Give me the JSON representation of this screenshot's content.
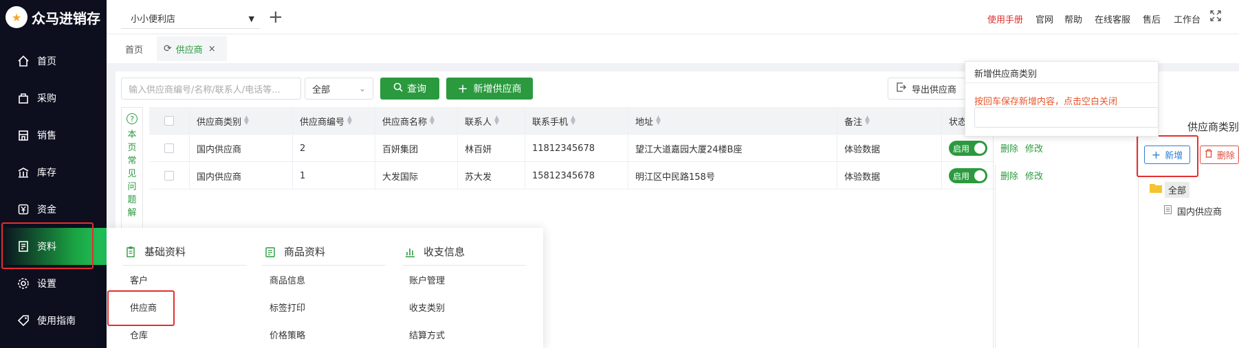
{
  "app": {
    "name": "众马进销存"
  },
  "sidebar": {
    "items": [
      {
        "label": "首页",
        "icon": "home-icon"
      },
      {
        "label": "采购",
        "icon": "bag-icon"
      },
      {
        "label": "销售",
        "icon": "shop-icon"
      },
      {
        "label": "库存",
        "icon": "warehouse-icon"
      },
      {
        "label": "资金",
        "icon": "yuan-icon"
      },
      {
        "label": "资料",
        "icon": "document-icon",
        "active": true
      },
      {
        "label": "设置",
        "icon": "gear-icon"
      },
      {
        "label": "使用指南",
        "icon": "tag-icon"
      }
    ]
  },
  "header": {
    "store": "小小便利店",
    "links": {
      "manual": "使用手册",
      "website": "官网",
      "help": "帮助",
      "service": "在线客服",
      "aftersale": "售后",
      "workbench": "工作台"
    },
    "accent": "#e02a2a"
  },
  "tabs": {
    "home": "首页",
    "current": "供应商",
    "close": "×"
  },
  "toolbar": {
    "search_placeholder": "输入供应商编号/名称/联系人/电话等...",
    "filter_value": "全部",
    "query_label": "查询",
    "add_label": "新增供应商",
    "export_label": "导出供应商"
  },
  "faq": {
    "text": "本页常见问题解"
  },
  "table": {
    "headers": [
      "供应商类别",
      "供应商编号",
      "供应商名称",
      "联系人",
      "联系手机",
      "地址",
      "备注",
      "状态"
    ],
    "rows": [
      {
        "category": "国内供应商",
        "code": "2",
        "name": "百妍集团",
        "contact": "林百妍",
        "phone": "11812345678",
        "address": "望江大道嘉园大厦24楼B座",
        "remark": "体验数据",
        "status": "启用",
        "actions": [
          "删除",
          "修改"
        ]
      },
      {
        "category": "国内供应商",
        "code": "1",
        "name": "大发国际",
        "contact": "苏大发",
        "phone": "15812345678",
        "address": "明江区中民路158号",
        "remark": "体验数据",
        "status": "启用",
        "actions": [
          "删除",
          "修改"
        ]
      }
    ]
  },
  "category_panel": {
    "title": "供应商类别",
    "add_label": "新增",
    "delete_label": "删除",
    "tree": {
      "root": "全部",
      "children": [
        "国内供应商"
      ]
    }
  },
  "popover": {
    "title": "新增供应商类别",
    "hint": "按回车保存新增内容，点击空白关闭",
    "input_value": ""
  },
  "mega_menu": {
    "sections": [
      {
        "title": "基础资料",
        "items": [
          "客户",
          "供应商",
          "仓库"
        ]
      },
      {
        "title": "商品资料",
        "items": [
          "商品信息",
          "标签打印",
          "价格策略"
        ]
      },
      {
        "title": "收支信息",
        "items": [
          "账户管理",
          "收支类别",
          "结算方式"
        ]
      }
    ]
  },
  "colors": {
    "brand_green": "#2b9a3f",
    "highlight_red": "#e52e2e",
    "sidebar_bg": "#0d0f1f"
  }
}
